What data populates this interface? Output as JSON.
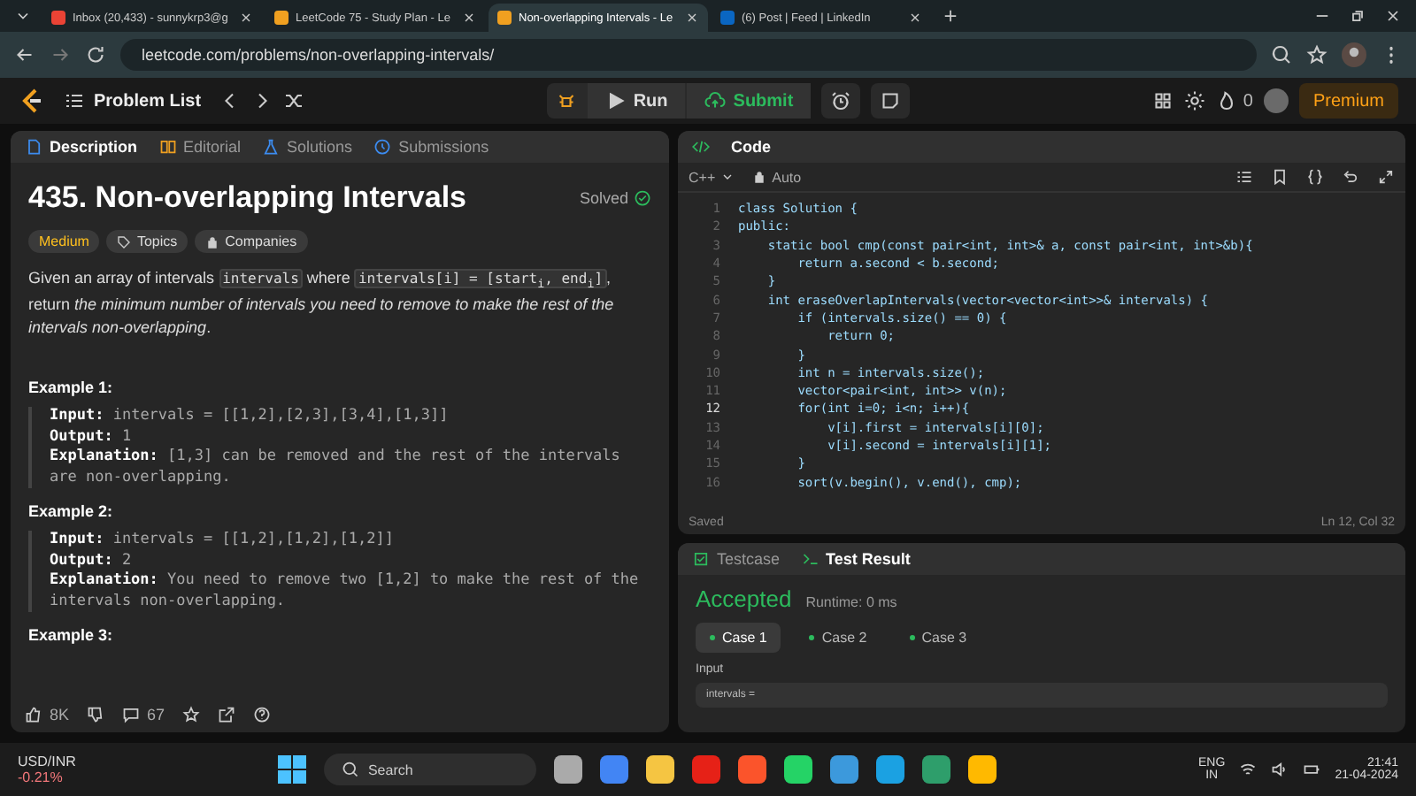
{
  "browser": {
    "tabs": [
      {
        "title": "Inbox (20,433) - sunnykrp3@g",
        "kind": "mail",
        "selected": false
      },
      {
        "title": "LeetCode 75 - Study Plan - Le",
        "kind": "lc",
        "selected": false
      },
      {
        "title": "Non-overlapping Intervals - Le",
        "kind": "lc",
        "selected": true
      },
      {
        "title": "(6) Post | Feed | LinkedIn",
        "kind": "in",
        "selected": false
      }
    ],
    "url": "leetcode.com/problems/non-overlapping-intervals/"
  },
  "nav": {
    "problem_list": "Problem List",
    "run": "Run",
    "submit": "Submit",
    "streak": "0",
    "premium": "Premium"
  },
  "description": {
    "tabs": [
      {
        "label": "Description",
        "selected": true
      },
      {
        "label": "Editorial",
        "selected": false
      },
      {
        "label": "Solutions",
        "selected": false
      },
      {
        "label": "Submissions",
        "selected": false
      }
    ],
    "title": "435. Non-overlapping Intervals",
    "status": "Solved",
    "tags": [
      {
        "label": "Medium",
        "kind": "difficulty"
      },
      {
        "label": "Topics",
        "kind": "topics"
      },
      {
        "label": "Companies",
        "kind": "companies"
      }
    ],
    "paragraph": [
      {
        "kind": "text",
        "text": "Given an array of intervals "
      },
      {
        "kind": "code",
        "text": "intervals"
      },
      {
        "kind": "text",
        "text": " where "
      },
      {
        "kind": "code",
        "text": "intervals[i] = [start$_{i}$, end$_{i}$]"
      },
      {
        "kind": "text",
        "text": ", return "
      },
      {
        "kind": "em",
        "text": "the minimum number of intervals you need to remove to make the rest of the intervals non-overlapping"
      },
      {
        "kind": "text",
        "text": "."
      }
    ],
    "examples": [
      {
        "heading": "Example 1:",
        "lines": [
          {
            "label": "Input:",
            "text": "intervals = [[1,2],[2,3],[3,4],[1,3]]"
          },
          {
            "label": "Output:",
            "text": "1"
          },
          {
            "label": "Explanation:",
            "text": "[1,3] can be removed and the rest of the intervals are non-overlapping."
          }
        ]
      },
      {
        "heading": "Example 2:",
        "lines": [
          {
            "label": "Input:",
            "text": "intervals = [[1,2],[1,2],[1,2]]"
          },
          {
            "label": "Output:",
            "text": "2"
          },
          {
            "label": "Explanation:",
            "text": "You need to remove two [1,2] to make the rest of the intervals non-overlapping."
          }
        ]
      },
      {
        "heading": "Example 3:"
      }
    ],
    "likes": "8K",
    "comments": "67"
  },
  "code": {
    "title": "Code",
    "language": "C++",
    "mode": "Auto",
    "lines": [
      {
        "num": "1",
        "text": "class Solution {",
        "active": false
      },
      {
        "num": "2",
        "text": "public:",
        "active": false
      },
      {
        "num": "3",
        "text": "    static bool cmp(const pair<int, int>& a, const pair<int, int>&b){",
        "active": false
      },
      {
        "num": "4",
        "text": "        return a.second < b.second;",
        "active": false
      },
      {
        "num": "5",
        "text": "    }",
        "active": false
      },
      {
        "num": "6",
        "text": "    int eraseOverlapIntervals(vector<vector<int>>& intervals) {",
        "active": false
      },
      {
        "num": "7",
        "text": "        if (intervals.size() == 0) {",
        "active": false
      },
      {
        "num": "8",
        "text": "            return 0;",
        "active": false
      },
      {
        "num": "9",
        "text": "        }",
        "active": false
      },
      {
        "num": "10",
        "text": "        int n = intervals.size();",
        "active": false
      },
      {
        "num": "11",
        "text": "        vector<pair<int, int>> v(n);",
        "active": false
      },
      {
        "num": "12",
        "text": "        for(int i=0; i<n; i++){",
        "active": true
      },
      {
        "num": "13",
        "text": "            v[i].first = intervals[i][0];",
        "active": false
      },
      {
        "num": "14",
        "text": "            v[i].second = intervals[i][1];",
        "active": false
      },
      {
        "num": "15",
        "text": "        }",
        "active": false
      },
      {
        "num": "16",
        "text": "        sort(v.begin(), v.end(), cmp);",
        "active": false
      }
    ],
    "status": "Saved",
    "cursor": "Ln 12, Col 32"
  },
  "result": {
    "tabs": [
      {
        "label": "Testcase",
        "selected": false
      },
      {
        "label": "Test Result",
        "selected": true
      }
    ],
    "verdict": "Accepted",
    "runtime": "Runtime: 0 ms",
    "cases": [
      {
        "label": "Case 1",
        "selected": true
      },
      {
        "label": "Case 2",
        "selected": false
      },
      {
        "label": "Case 3",
        "selected": false
      }
    ],
    "input_label": "Input",
    "input_value": "intervals ="
  },
  "taskbar": {
    "ticker": "USD/INR",
    "change": "-0.21%",
    "search": "Search",
    "lang": "ENG",
    "region": "IN",
    "time": "21:41",
    "date": "21-04-2024"
  }
}
